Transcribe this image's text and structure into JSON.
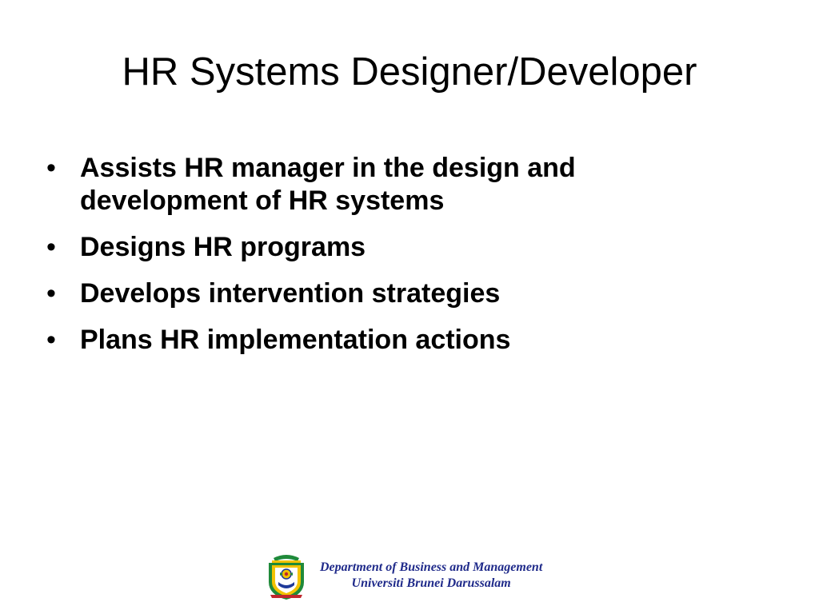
{
  "slide": {
    "title": "HR Systems Designer/Developer",
    "bullet_glyph": "•",
    "bullets": [
      "Assists HR manager in the design and development of HR systems",
      "Designs HR programs",
      "Develops intervention strategies",
      "Plans HR implementation actions"
    ]
  },
  "footer": {
    "line1": "Department of Business and Management",
    "line2": "Universiti Brunei Darussalam",
    "logo_icon": "university-crest-icon"
  },
  "colors": {
    "background": "#ffffff",
    "text": "#000000",
    "footer_text": "#1f2a8a",
    "crest_green": "#1f8a3a",
    "crest_yellow": "#f2c200",
    "crest_blue": "#1f3a9a",
    "crest_red": "#c0272d"
  }
}
